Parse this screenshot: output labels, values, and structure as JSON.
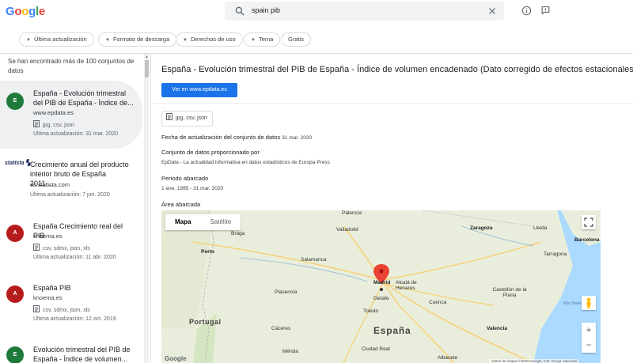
{
  "header": {
    "logo": "Google",
    "search_value": "spain pib"
  },
  "filters": [
    {
      "label": "Última actualización",
      "has_caret": true
    },
    {
      "label": "Formato de descarga",
      "has_caret": true
    },
    {
      "label": "Derechos de uso",
      "has_caret": true
    },
    {
      "label": "Tema",
      "has_caret": true
    },
    {
      "label": "Gratis",
      "has_caret": false
    }
  ],
  "results": {
    "count_text": "Se han encontrado más de 100 conjuntos de datos",
    "items": [
      {
        "avatar": "E",
        "title": "España - Evolución trimestral del PIB de España - Índice de...",
        "source": "www.epdata.es",
        "formats": "jpg, csv, json",
        "updated": "Última actualización: 31 mar. 2020"
      },
      {
        "avatar": "statista",
        "title": "Crecimiento anual del producto interior bruto de España 2011-...",
        "source": "es.statista.com",
        "formats": "",
        "updated": "Última actualización: 7 jun. 2020"
      },
      {
        "avatar": "A",
        "title": "España Crecimiento real del PIB",
        "source": "knoema.es",
        "formats": "csv, sdmx, json, xls",
        "updated": "Última actualización: 11 abr. 2020"
      },
      {
        "avatar": "A",
        "title": "España PIB",
        "source": "knoema.es",
        "formats": "csv, sdmx, json, xls",
        "updated": "Última actualización: 12 oct. 2019"
      },
      {
        "avatar": "E",
        "title": "Evolución trimestral del PIB de España - Índice de volumen...",
        "source": "",
        "formats": "",
        "updated": ""
      }
    ]
  },
  "detail": {
    "title": "España - Evolución trimestral del PIB de España - Índice de volumen encadenado (Dato corregido de efectos estacionales)",
    "visit_button": "Ver en www.epdata.es",
    "formats": "jpg, csv, json",
    "updated_label": "Fecha de actualización del conjunto de datos",
    "updated_value": "31 mar. 2020",
    "provider_label": "Conjunto de datos proporcionado por",
    "provider_value": "EpData - La actualidad informativa en datos estadísticos de Europa Press",
    "period_label": "Periodo abarcado",
    "period_value": "1 ene. 1995 - 31 mar. 2020",
    "area_label": "Área abarcada"
  },
  "map": {
    "tab_map": "Mapa",
    "tab_satellite": "Satélite",
    "zoom_in": "+",
    "zoom_out": "−",
    "attribution": "Datos de mapas ©2020 Google, Inst. Geogr. Nacional",
    "logo": "Google",
    "labels": {
      "palencia": "Palencia",
      "braga": "Braga",
      "valladolid": "Valladolid",
      "zaragoza": "Zaragoza",
      "lleida": "Lleida",
      "barcelona": "Barcelona",
      "porto": "Porto",
      "salamanca": "Salamanca",
      "tarragona": "Tarragona",
      "madrid": "Madrid",
      "alcala": "Alcalá de Henares",
      "getafe": "Getafe",
      "portugal": "Portugal",
      "plasencia": "Plasencia",
      "cuenca": "Cuenca",
      "toledo": "Toledo",
      "castellon": "Castellón de la Plana",
      "espana": "España",
      "caceres": "Cáceres",
      "valencia": "Valencia",
      "merida": "Mérida",
      "ciudad_real": "Ciudad Real",
      "albacete": "Albacete",
      "sea": "Mar Balear"
    }
  }
}
